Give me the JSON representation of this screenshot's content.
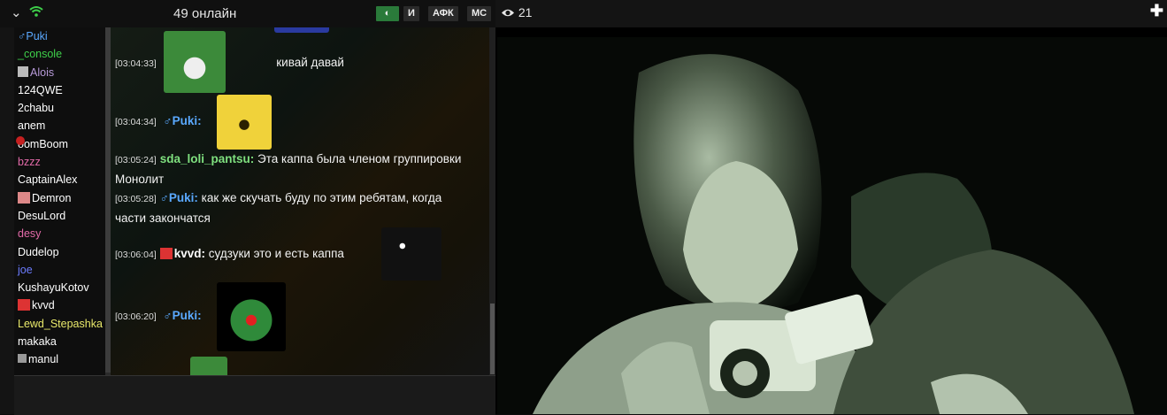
{
  "header": {
    "chevron_icon": "chevron-down-icon",
    "wifi_icon": "wifi-icon",
    "online_text": "49 онлайн",
    "buttons": {
      "toggle": "◐",
      "i": "И",
      "afk": "АФК",
      "mc": "МС"
    }
  },
  "users": [
    {
      "name": "♂Puki",
      "color": "#5aa9ff"
    },
    {
      "name": "_console",
      "color": "#3ecf4a"
    },
    {
      "name": "Alois",
      "color": "#b79ad8"
    },
    {
      "name": "124QWE",
      "color": "#ffffff"
    },
    {
      "name": "2chabu",
      "color": "#ffffff"
    },
    {
      "name": "anem",
      "color": "#ffffff"
    },
    {
      "name": "oomBoom",
      "color": "#ffffff"
    },
    {
      "name": "bzzz",
      "color": "#e26aa8"
    },
    {
      "name": "CaptainAlex",
      "color": "#ffffff"
    },
    {
      "name": "Demron",
      "color": "#ffffff"
    },
    {
      "name": "DesuLord",
      "color": "#ffffff"
    },
    {
      "name": "desy",
      "color": "#e26aa8"
    },
    {
      "name": "Dudelop",
      "color": "#ffffff"
    },
    {
      "name": "joe",
      "color": "#6c7cff"
    },
    {
      "name": "KushayuKotov",
      "color": "#ffffff"
    },
    {
      "name": "kvvd",
      "color": "#ffffff"
    },
    {
      "name": "Lewd_Stepashka",
      "color": "#e8e86a"
    },
    {
      "name": "makaka",
      "color": "#ffffff"
    },
    {
      "name": "manul",
      "color": "#ffffff"
    }
  ],
  "messages": [
    {
      "time": "[03:04:33]",
      "nick": "",
      "text": "кивай давай"
    },
    {
      "time": "[03:04:34]",
      "nick": "♂Puki:",
      "text": ""
    },
    {
      "time": "[03:05:24]",
      "nick": "sda_loli_pantsu:",
      "text": "Эта каппа была членом группировки Монолит"
    },
    {
      "time": "[03:05:28]",
      "nick": "♂Puki:",
      "text": "как же скучать буду по этим ребятам, когда части закончатся"
    },
    {
      "time": "[03:06:04]",
      "nick": "kvvd:",
      "text": "судзуки это и есть каппа"
    },
    {
      "time": "[03:06:20]",
      "nick": "♂Puki:",
      "text": ""
    }
  ],
  "colors": {
    "puki": "#5aa9ff",
    "sda": "#7fe07f",
    "kvvd": "#ffffff"
  },
  "player": {
    "eye_icon": "eye-icon",
    "viewers": "21",
    "add_icon": "plus-icon"
  }
}
